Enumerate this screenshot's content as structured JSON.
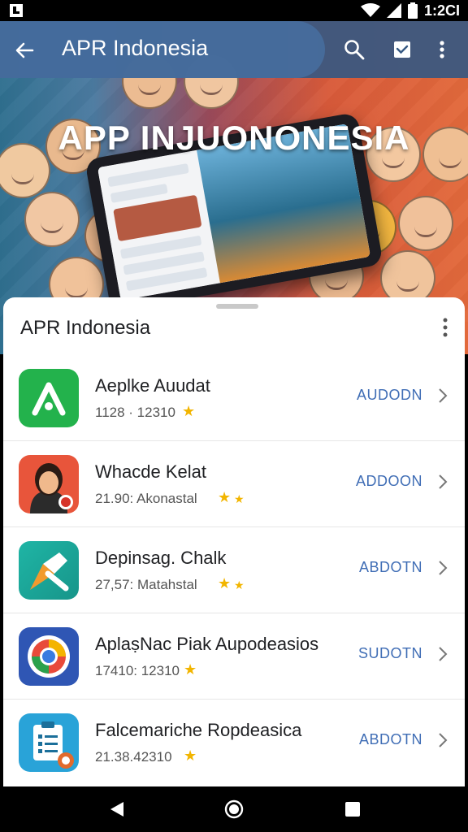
{
  "status_bar": {
    "time": "1:2CI",
    "icons": [
      "notification-icon",
      "wifi-icon",
      "signal-icon",
      "battery-icon"
    ]
  },
  "app_bar": {
    "title": "APR Indonesia",
    "icons": [
      "back-arrow-icon",
      "search-icon",
      "mail-check-icon",
      "overflow-menu-icon"
    ]
  },
  "banner": {
    "text": "APP INJUONONESIA"
  },
  "sheet": {
    "title": "APR Indonesia",
    "apps": [
      {
        "name": "Aeplke Auudat",
        "meta": "1128 · 12310",
        "action": "AUDODN",
        "icon": "letter-a-icon",
        "icon_color": "#23b24c"
      },
      {
        "name": "Whacde Kelat",
        "meta": "21.90: Akonastal",
        "action": "ADDOON",
        "icon": "avatar-icon",
        "icon_color": "#e8553b"
      },
      {
        "name": "Depinsag. Chalk",
        "meta": "27,57: Matahstal",
        "action": "ABDOTN",
        "icon": "pencil-arrow-icon",
        "icon_color": "#1ea99a"
      },
      {
        "name": "AplaṣNac Piak Aupodeasios",
        "meta": "17410: 12310",
        "action": "SUDOTN",
        "icon": "chrome-circle-icon",
        "icon_color": "#2f56b4"
      },
      {
        "name": "Falcemariche Ropdeasica",
        "meta": "21.38.42310",
        "action": "ABDOTN",
        "icon": "clipboard-icon",
        "icon_color": "#29a3d8"
      }
    ]
  },
  "colors": {
    "accent": "#3f6db5",
    "app_bar": "#365882",
    "star": "#f2b500"
  },
  "nav_bar": {
    "icons": [
      "back-triangle-icon",
      "home-circle-icon",
      "recents-square-icon"
    ]
  }
}
